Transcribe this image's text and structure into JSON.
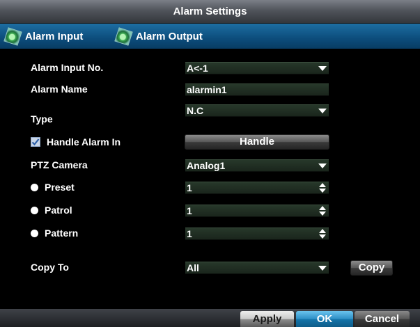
{
  "window": {
    "title": "Alarm Settings"
  },
  "tabs": [
    {
      "label": "Alarm Input",
      "icon": "monitor-icon"
    },
    {
      "label": "Alarm Output",
      "icon": "monitor-icon"
    }
  ],
  "form": {
    "alarm_input_no": {
      "label": "Alarm Input No.",
      "value": "A<-1"
    },
    "alarm_name": {
      "label": "Alarm Name",
      "value": "alarmin1"
    },
    "type": {
      "label": "Type",
      "value": "N.C"
    },
    "handle_alarm_in": {
      "label": "Handle Alarm In",
      "checked": true,
      "button_label": "Handle"
    },
    "ptz_camera": {
      "label": "PTZ Camera",
      "value": "Analog1"
    },
    "preset": {
      "label": "Preset",
      "value": "1"
    },
    "patrol": {
      "label": "Patrol",
      "value": "1"
    },
    "pattern": {
      "label": "Pattern",
      "value": "1"
    },
    "copy_to": {
      "label": "Copy To",
      "value": "All",
      "button_label": "Copy"
    }
  },
  "footer": {
    "apply_label": "Apply",
    "ok_label": "OK",
    "cancel_label": "Cancel"
  },
  "colors": {
    "title_bar": "#50545b",
    "tab_bar": "#0c4c7b",
    "ok_accent": "#2d8fc5",
    "field_bg": "#27382a"
  }
}
